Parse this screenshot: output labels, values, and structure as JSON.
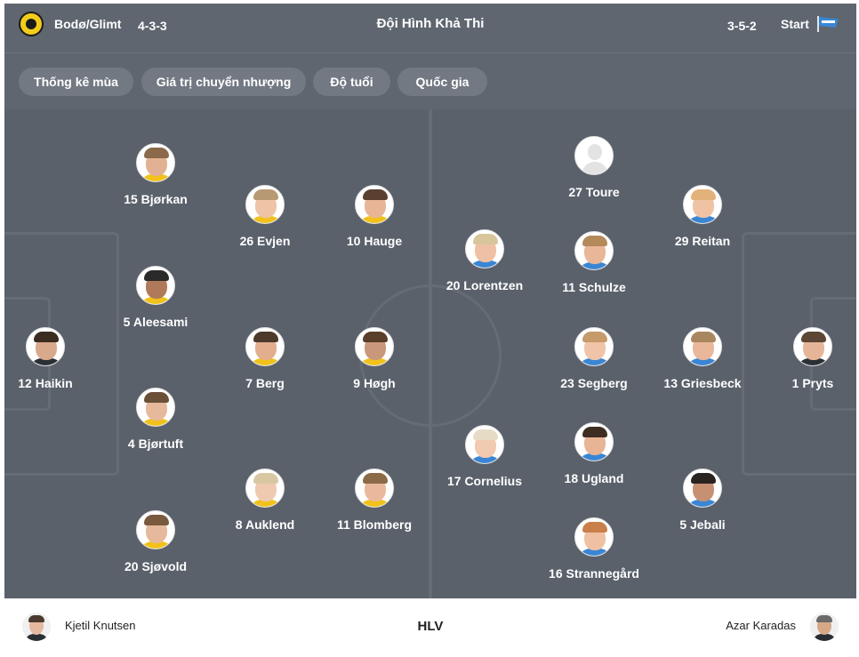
{
  "header": {
    "title": "Đội Hình Khả Thi",
    "home_team": "Bodø/Glimt",
    "home_formation": "4-3-3",
    "away_formation": "3-5-2",
    "away_status": "Start",
    "home_badge_icon": "bodo-glimt-badge-icon",
    "away_badge_icon": "start-flag-icon"
  },
  "filters": [
    {
      "label": "Thống kê mùa"
    },
    {
      "label": "Giá trị chuyển nhượng"
    },
    {
      "label": "Độ tuổi"
    },
    {
      "label": "Quốc gia"
    }
  ],
  "colors": {
    "header_bg": "#5f6670",
    "pitch_bg": "#5a616b",
    "pitch_lines": "#656c75",
    "chip_bg": "#727983",
    "text": "#ffffff"
  },
  "home_players": [
    {
      "label": "12 Haikin"
    },
    {
      "label": "15 Bjørkan"
    },
    {
      "label": "5 Aleesami"
    },
    {
      "label": "4 Bjørtuft"
    },
    {
      "label": "20 Sjøvold"
    },
    {
      "label": "26 Evjen"
    },
    {
      "label": "7 Berg"
    },
    {
      "label": "8 Auklend"
    },
    {
      "label": "10 Hauge"
    },
    {
      "label": "9 Høgh"
    },
    {
      "label": "11 Blomberg"
    }
  ],
  "away_players": [
    {
      "label": "27 Toure"
    },
    {
      "label": "29 Reitan"
    },
    {
      "label": "20 Lorentzen"
    },
    {
      "label": "11 Schulze"
    },
    {
      "label": "23 Segberg"
    },
    {
      "label": "13 Griesbeck"
    },
    {
      "label": "1 Pryts"
    },
    {
      "label": "17 Cornelius"
    },
    {
      "label": "18 Ugland"
    },
    {
      "label": "5 Jebali"
    },
    {
      "label": "16 Strannegård"
    }
  ],
  "coaches": {
    "label": "HLV",
    "home": "Kjetil Knutsen",
    "away": "Azar Karadas"
  }
}
